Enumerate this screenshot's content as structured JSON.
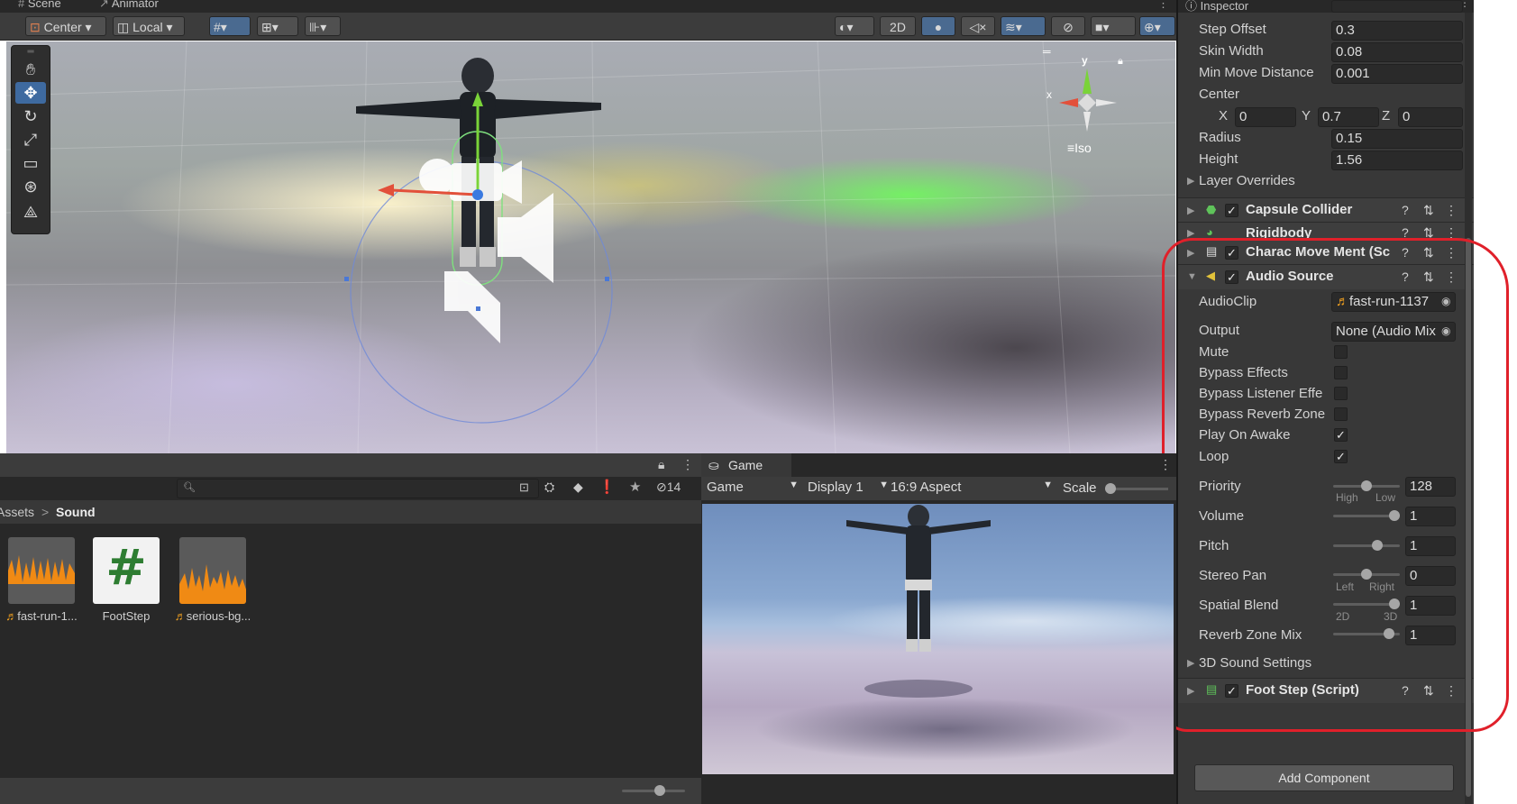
{
  "scene": {
    "tabs": [
      "Scene",
      "Animator"
    ],
    "toolbar": {
      "pivot": "Center",
      "space": "Local",
      "mode_2d": "2D"
    },
    "gizmo": {
      "x_axis": "x",
      "y_axis": "y",
      "projection": "Iso"
    }
  },
  "inspector": {
    "tab": "Inspector",
    "controller_rows": [
      {
        "label": "Step Offset",
        "value": "0.3"
      },
      {
        "label": "Skin Width",
        "value": "0.08"
      },
      {
        "label": "Min Move Distance",
        "value": "0.001"
      }
    ],
    "center": {
      "label": "Center",
      "x_label": "X",
      "x": "0",
      "y_label": "Y",
      "y": "0.7",
      "z_label": "Z",
      "z": "0"
    },
    "radius": {
      "label": "Radius",
      "value": "0.15"
    },
    "height": {
      "label": "Height",
      "value": "1.56"
    },
    "layer_overrides": "Layer Overrides",
    "components": {
      "capsule_collider": "Capsule Collider",
      "rigidbody": "Rigidbody",
      "move_script": "Charac Move Ment (Sc",
      "audio_source": "Audio Source",
      "footstep": "Foot Step (Script)"
    },
    "audio": {
      "audioclip_label": "AudioClip",
      "audioclip_value": "fast-run-1137",
      "output_label": "Output",
      "output_value": "None (Audio Mix",
      "mute": {
        "label": "Mute",
        "checked": false
      },
      "bypass_effects": {
        "label": "Bypass Effects",
        "checked": false
      },
      "bypass_listener": {
        "label": "Bypass Listener Effe",
        "checked": false
      },
      "bypass_reverb": {
        "label": "Bypass Reverb Zone",
        "checked": false
      },
      "play_on_awake": {
        "label": "Play On Awake",
        "checked": true
      },
      "loop": {
        "label": "Loop",
        "checked": true
      },
      "priority": {
        "label": "Priority",
        "value": "128",
        "min_label": "High",
        "max_label": "Low",
        "level": 0.5
      },
      "volume": {
        "label": "Volume",
        "value": "1",
        "level": 1.0
      },
      "pitch": {
        "label": "Pitch",
        "value": "1",
        "level": 0.7
      },
      "stereo_pan": {
        "label": "Stereo Pan",
        "value": "0",
        "min_label": "Left",
        "max_label": "Right",
        "level": 0.5
      },
      "spatial_blend": {
        "label": "Spatial Blend",
        "value": "1",
        "min_label": "2D",
        "max_label": "3D",
        "level": 1.0
      },
      "reverb_zone_mix": {
        "label": "Reverb Zone Mix",
        "value": "1",
        "level": 0.9
      },
      "sound_settings": "3D Sound Settings"
    },
    "add_component": "Add Component"
  },
  "project": {
    "hidden_count": "14",
    "breadcrumb": {
      "parent": "Assets",
      "separator": ">",
      "current": "Sound"
    },
    "assets": [
      {
        "name": "fast-run-1...",
        "type": "audio"
      },
      {
        "name": "FootStep",
        "type": "script",
        "glyph": "#"
      },
      {
        "name": "serious-bg...",
        "type": "audio"
      }
    ]
  },
  "game": {
    "tab": "Game",
    "dropdown_game": "Game",
    "display": "Display 1",
    "aspect": "16:9 Aspect",
    "scale_label": "Scale"
  },
  "colors": {
    "accent": "#3e6aa0",
    "annotation": "#e0202a",
    "audio_wave": "#f08a14"
  }
}
